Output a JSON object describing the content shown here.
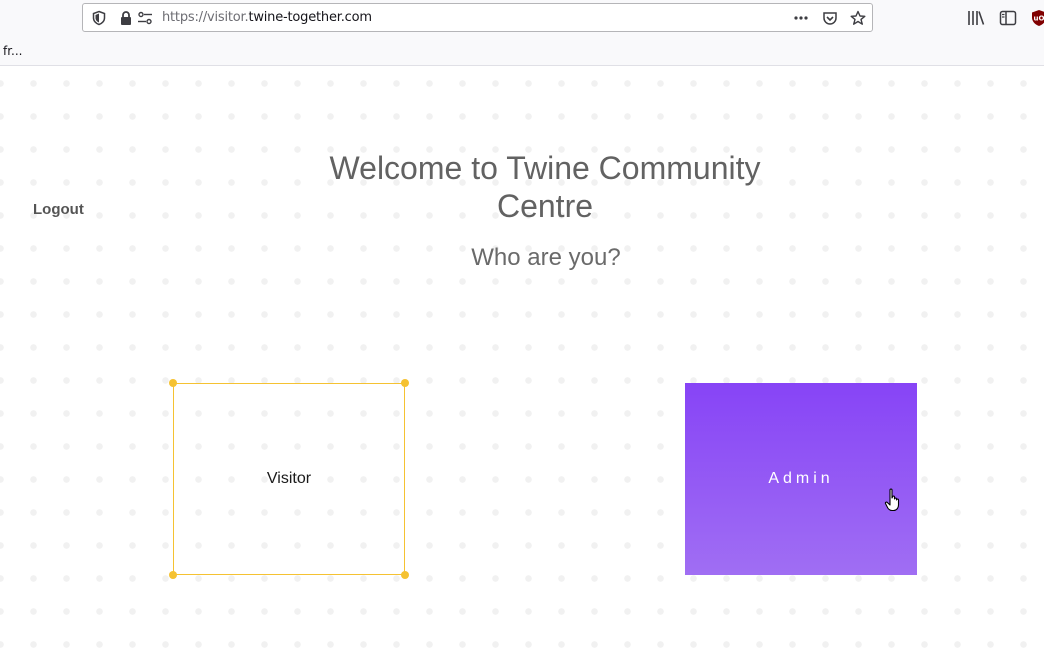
{
  "browser": {
    "url_prefix": "https://visitor.",
    "url_host": "twine-together.com",
    "bookmark": "fr..."
  },
  "page": {
    "logout": "Logout",
    "title": "Welcome to Twine Community Centre",
    "subtitle": "Who are you?",
    "cards": {
      "visitor": "Visitor",
      "admin": "Admin"
    }
  },
  "colors": {
    "accent_yellow": "#f5c232",
    "admin_gradient_top": "#8744f6",
    "admin_gradient_bottom": "#a06ef3"
  },
  "icons": [
    "shield-icon",
    "lock-icon",
    "permissions-icon",
    "more-icon",
    "pocket-icon",
    "bookmark-star-icon",
    "library-icon",
    "sidebar-icon",
    "ublock-icon",
    "hand-cursor-icon"
  ]
}
